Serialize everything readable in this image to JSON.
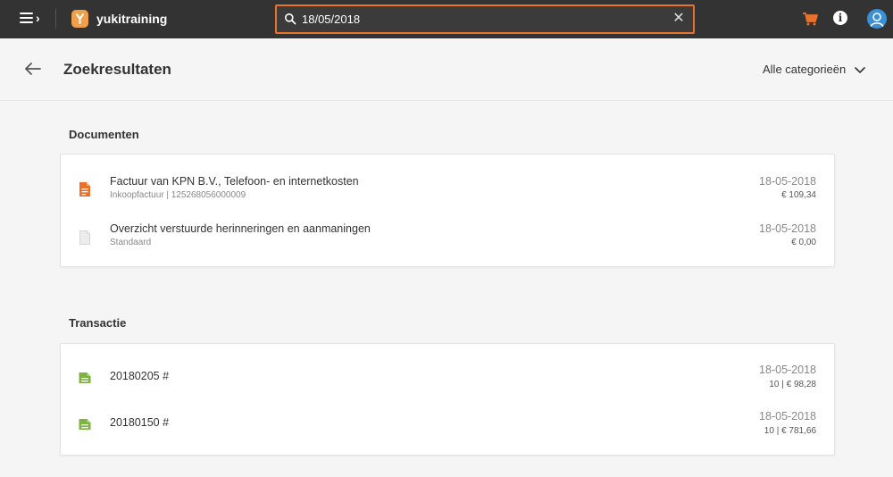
{
  "topbar": {
    "app_name": "yukitraining",
    "search_value": "18/05/2018",
    "icons": [
      "menu-icon",
      "logo-icon",
      "search-icon",
      "close-icon",
      "cart-icon",
      "info-icon",
      "user-icon"
    ],
    "accent": "#e8722b"
  },
  "header": {
    "title": "Zoekresultaten",
    "category_label": "Alle categorieën"
  },
  "documents": {
    "title": "Documenten",
    "items": [
      {
        "title": "Factuur van KPN B.V., Telefoon- en internetkosten",
        "subtitle": "Inkoopfactuur | 125268056000009",
        "date": "18-05-2018",
        "amount": "€ 109,34",
        "icon": "invoice-icon"
      },
      {
        "title": "Overzicht verstuurde herinneringen en aanmaningen",
        "subtitle": "Standaard",
        "date": "18-05-2018",
        "amount": "€ 0,00",
        "icon": "document-icon"
      }
    ]
  },
  "transactions": {
    "title": "Transactie",
    "items": [
      {
        "title": "20180205 #",
        "date": "18-05-2018",
        "amount": "10 | € 98,28",
        "icon": "transaction-icon"
      },
      {
        "title": "20180150 #",
        "date": "18-05-2018",
        "amount": "10 | € 781,66",
        "icon": "transaction-icon"
      }
    ]
  }
}
